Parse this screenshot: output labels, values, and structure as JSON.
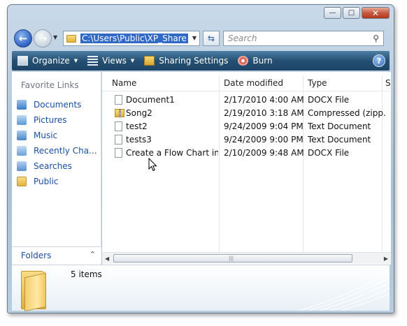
{
  "address_bar": {
    "path": "C:\\Users\\Public\\XP_Share"
  },
  "search": {
    "placeholder": "Search"
  },
  "toolbar": {
    "organize": "Organize",
    "views": "Views",
    "sharing": "Sharing Settings",
    "burn": "Burn"
  },
  "navigation": {
    "title": "Favorite Links",
    "items": [
      {
        "label": "Documents",
        "icon": "documents-icon",
        "color": "#3a7cc7"
      },
      {
        "label": "Pictures",
        "icon": "pictures-icon",
        "color": "#5b9bd5"
      },
      {
        "label": "Music",
        "icon": "music-icon",
        "color": "#4a86c8"
      },
      {
        "label": "Recently Cha...",
        "icon": "recently-changed-icon",
        "color": "#6a9fd8"
      },
      {
        "label": "Searches",
        "icon": "searches-icon",
        "color": "#5a8fce"
      },
      {
        "label": "Public",
        "icon": "public-folder-icon",
        "color": "#e6b840"
      }
    ],
    "folders_label": "Folders"
  },
  "columns": [
    "Name",
    "Date modified",
    "Type",
    "S"
  ],
  "files": [
    {
      "name": "Document1",
      "date": "2/17/2010 4:00 AM",
      "type": "DOCX File",
      "icon": "document-icon"
    },
    {
      "name": "Song2",
      "date": "2/19/2010 3:18 AM",
      "type": "Compressed (zipp...",
      "icon": "zip-folder-icon"
    },
    {
      "name": "test2",
      "date": "9/24/2009 9:04 PM",
      "type": "Text Document",
      "icon": "text-document-icon"
    },
    {
      "name": "tests3",
      "date": "9/24/2009 9:00 PM",
      "type": "Text Document",
      "icon": "text-document-icon"
    },
    {
      "name": "Create a Flow Chart in ...",
      "date": "2/10/2009 9:48 AM",
      "type": "DOCX File",
      "icon": "document-icon"
    }
  ],
  "details": {
    "count": "5 items"
  },
  "colors": {
    "toolbar": "#254f72",
    "link": "#1a4fa0",
    "selection": "#3169c6",
    "close": "#c5553a"
  }
}
